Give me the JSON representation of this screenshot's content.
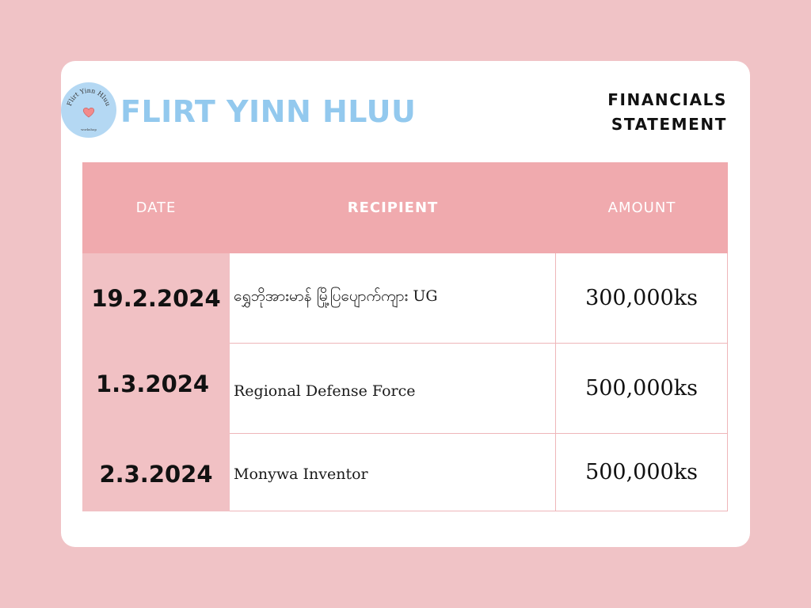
{
  "brand": {
    "name": "FLIRT YINN HLUU",
    "logo_text_top": "Flirt Yinn Hluu",
    "logo_text_bottom": "workshop",
    "logo_icon": "heart-icon",
    "logo_color": "#b4d8f3",
    "brand_color": "#93c9ee"
  },
  "statement": {
    "line1": "FINANCIALS",
    "line2": "STATEMENT"
  },
  "table": {
    "headers": {
      "date": "DATE",
      "recipient": "RECIPIENT",
      "amount": "AMOUNT"
    },
    "rows": [
      {
        "date": "19.2.2024",
        "recipient": "ရွှေဘိုအားမာန် မြို့ပြပျောက်ကျား UG",
        "amount": "300,000ks"
      },
      {
        "date": "1.3.2024",
        "recipient": "Regional Defense Force",
        "amount": "500,000ks"
      },
      {
        "date": "2.3.2024",
        "recipient": "Monywa Inventor",
        "amount": "500,000ks"
      }
    ],
    "header_color": "#f0aaae",
    "date_column_color": "#f1c1c4"
  },
  "colors": {
    "page_background": "#f0c3c6",
    "card_background": "#ffffff"
  }
}
